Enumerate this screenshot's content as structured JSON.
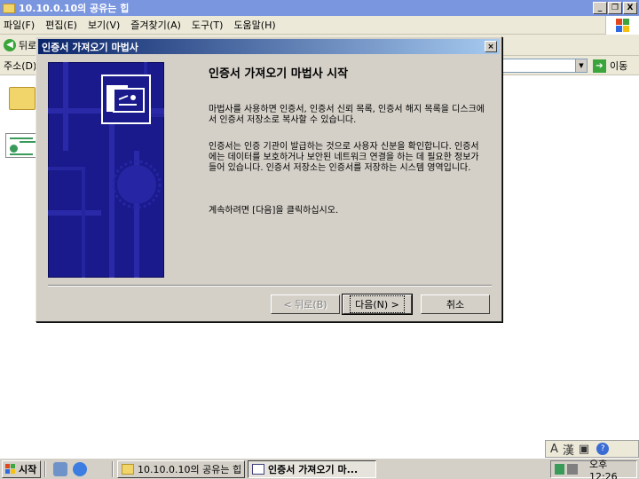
{
  "explorer": {
    "title": "10.10.0.10의 공유는 힙",
    "menu": [
      "파일(F)",
      "편집(E)",
      "보기(V)",
      "즐겨찾기(A)",
      "도구(T)",
      "도움말(H)"
    ],
    "back_label": "뒤로",
    "address_label": "주소(D)",
    "go_label": "이동",
    "window_buttons": {
      "minimize": "_",
      "restore": "❐",
      "close": "X"
    }
  },
  "dialog": {
    "title": "인증서 가져오기 마법사",
    "close_label": "×",
    "heading": "인증서 가져오기 마법사 시작",
    "paragraphs": [
      "마법사를 사용하면 인증서, 인증서 신뢰 목록, 인증서 해지 목록을 디스크에서 인증서 저장소로 복사할 수 있습니다.",
      "인증서는 인증 기관이 발급하는 것으로 사용자 신분을 확인합니다. 인증서에는 데이터를 보호하거나 보안된 네트워크 연결을 하는 데 필요한 정보가 들어 있습니다. 인증서 저장소는 인증서를 저장하는 시스템 영역입니다.",
      "계속하려면 [다음]을 클릭하십시오."
    ],
    "buttons": {
      "back": "< 뒤로(B)",
      "next": "다음(N) >",
      "cancel": "취소"
    }
  },
  "ime": {
    "a": "A",
    "han": "漢",
    "help": "?"
  },
  "taskbar": {
    "start_label": "시작",
    "tasks": [
      "10.10.0.10의 공유는 힙",
      "인증서 가져오기 마..."
    ],
    "clock": "오후 12:26"
  },
  "colors": {
    "dialog_title_start": "#0a246a",
    "dialog_title_end": "#a6caf0",
    "wizard_art": "#1a1a8c",
    "xp_red": "#e2461c",
    "xp_green": "#3fa63f",
    "xp_blue": "#2d6ae0",
    "xp_yellow": "#f5c10e"
  }
}
